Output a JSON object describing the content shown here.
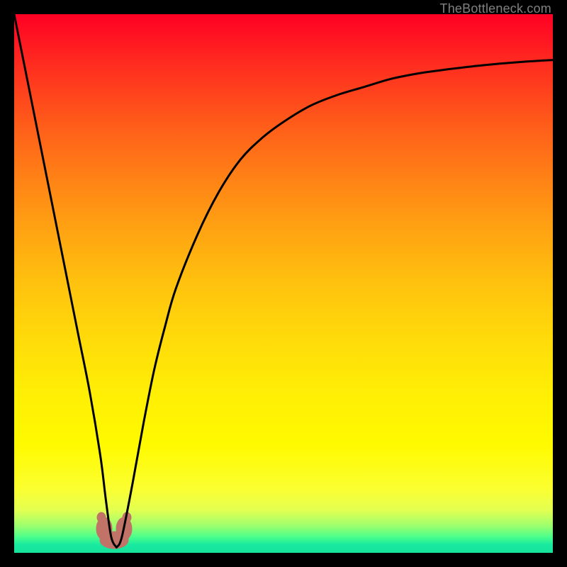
{
  "attribution": "TheBottleneck.com",
  "colors": {
    "gradient_top": "#ff0024",
    "gradient_mid": "#ffda0a",
    "gradient_bottom": "#16e29c",
    "curve": "#000000",
    "footprint_fill": "#c27367",
    "frame_bg": "#000000",
    "attribution_text": "#808080"
  },
  "chart_data": {
    "type": "line",
    "title": "",
    "xlabel": "",
    "ylabel": "",
    "xlim": [
      0,
      100
    ],
    "ylim": [
      0,
      100
    ],
    "grid": false,
    "legend": false,
    "annotations": [],
    "series": [
      {
        "name": "bottleneck-curve",
        "x": [
          0,
          2,
          4,
          6,
          8,
          10,
          12,
          14,
          16,
          17,
          18,
          19,
          20,
          22,
          24,
          26,
          28,
          30,
          34,
          38,
          42,
          46,
          50,
          55,
          60,
          65,
          70,
          75,
          80,
          85,
          90,
          95,
          100
        ],
        "y": [
          100,
          90,
          80,
          70,
          60,
          50,
          40,
          30,
          18,
          10,
          3,
          1,
          3,
          13,
          24,
          34,
          42,
          49,
          59,
          67,
          73,
          77,
          80,
          83,
          85,
          86.5,
          88,
          89,
          89.7,
          90.3,
          90.8,
          91.2,
          91.5
        ]
      }
    ],
    "markers": [
      {
        "name": "footprint",
        "shape": "rounded-u",
        "approx_center_x": 19,
        "approx_center_y": 2,
        "approx_width_x": 6,
        "approx_height_y": 6,
        "color": "#c27367"
      }
    ],
    "notes": "Axes are unlabeled in the source image. x and y normalized 0–100. y measured as distance from green band (0) to top (100). Curve descends steeply from top-left to a cusp near x≈19, then rises with decreasing slope toward upper right."
  }
}
